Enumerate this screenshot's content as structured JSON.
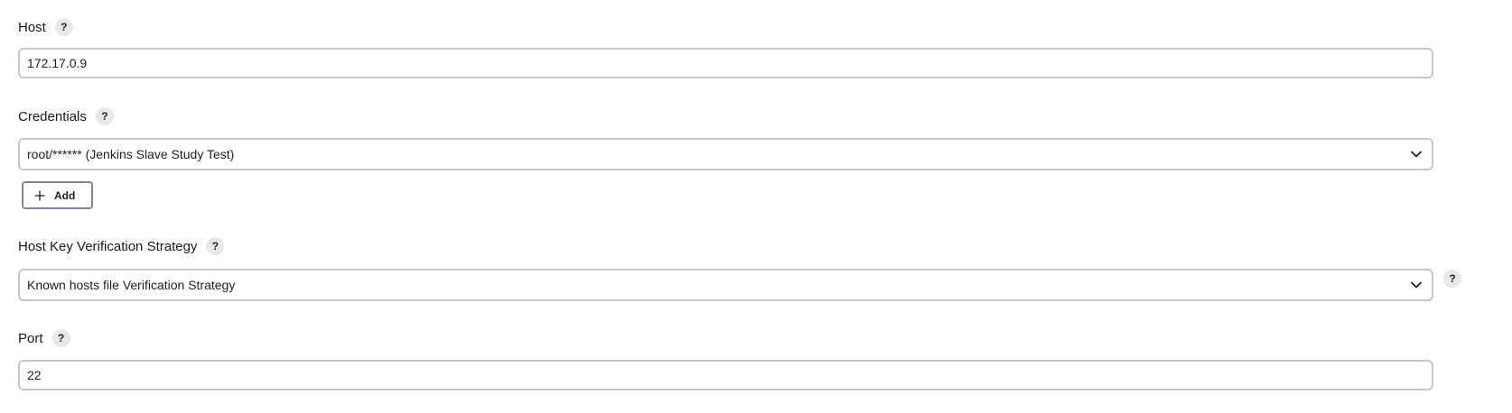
{
  "help_glyph": "?",
  "host": {
    "label": "Host",
    "value": "172.17.0.9"
  },
  "credentials": {
    "label": "Credentials",
    "selected": "root/****** (Jenkins Slave Study Test)",
    "add_label": "Add"
  },
  "host_key": {
    "label": "Host Key Verification Strategy",
    "selected": "Known hosts file Verification Strategy"
  },
  "port": {
    "label": "Port",
    "value": "22"
  },
  "icons": {
    "help": "help-icon",
    "chevron": "chevron-down-icon",
    "plus": "plus-icon"
  }
}
